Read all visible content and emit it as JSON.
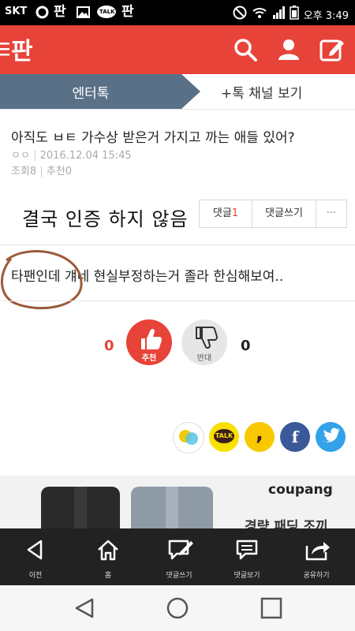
{
  "status_bar": {
    "carrier": "SKT",
    "notif_pan_1": "판",
    "notif_pan_2": "판",
    "notif_talk": "TALK",
    "time": "오후 3:49"
  },
  "header": {
    "logo": "판",
    "icons": [
      "menu-icon",
      "search-icon",
      "user-icon",
      "edit-icon"
    ]
  },
  "tabs": {
    "active": "엔터톡",
    "other": "+톡 채널 보기"
  },
  "post": {
    "title": "아직도 ㅂㅌ 가수상 받은거 가지고 까는 애들 있어?",
    "author": "ㅇㅇ",
    "date": "2016.12.04 15:45",
    "views_label": "조회",
    "views": "8",
    "recommend_label": "추천",
    "recommend": "0",
    "handwritten_note": "결국 인증 하지 않음",
    "body": "타팬인데 걔네 현실부정하는거 졸라 한심해보여.."
  },
  "comment_bar": {
    "comments_label": "댓글",
    "comments_count": "1",
    "write_label": "댓글쓰기",
    "more": "···"
  },
  "votes": {
    "up_count": "0",
    "up_label": "추천",
    "down_count": "0",
    "down_label": "반대"
  },
  "share": {
    "kakaotalk_label": "TALK",
    "kakaostory_label": ",",
    "facebook_label": "f"
  },
  "ad": {
    "brand": "coupang",
    "text": "경량 패딩 조끼"
  },
  "toolbar": {
    "items": [
      {
        "label": "이전"
      },
      {
        "label": "홈"
      },
      {
        "label": "댓글쓰기"
      },
      {
        "label": "댓글보기"
      },
      {
        "label": "공유하기"
      }
    ]
  },
  "colors": {
    "brand_red": "#e84339",
    "tab_active": "#5a7087",
    "comment_count": "#e84339",
    "facebook": "#3b5998",
    "twitter": "#33a2e8",
    "kakao_yellow": "#fee500"
  }
}
